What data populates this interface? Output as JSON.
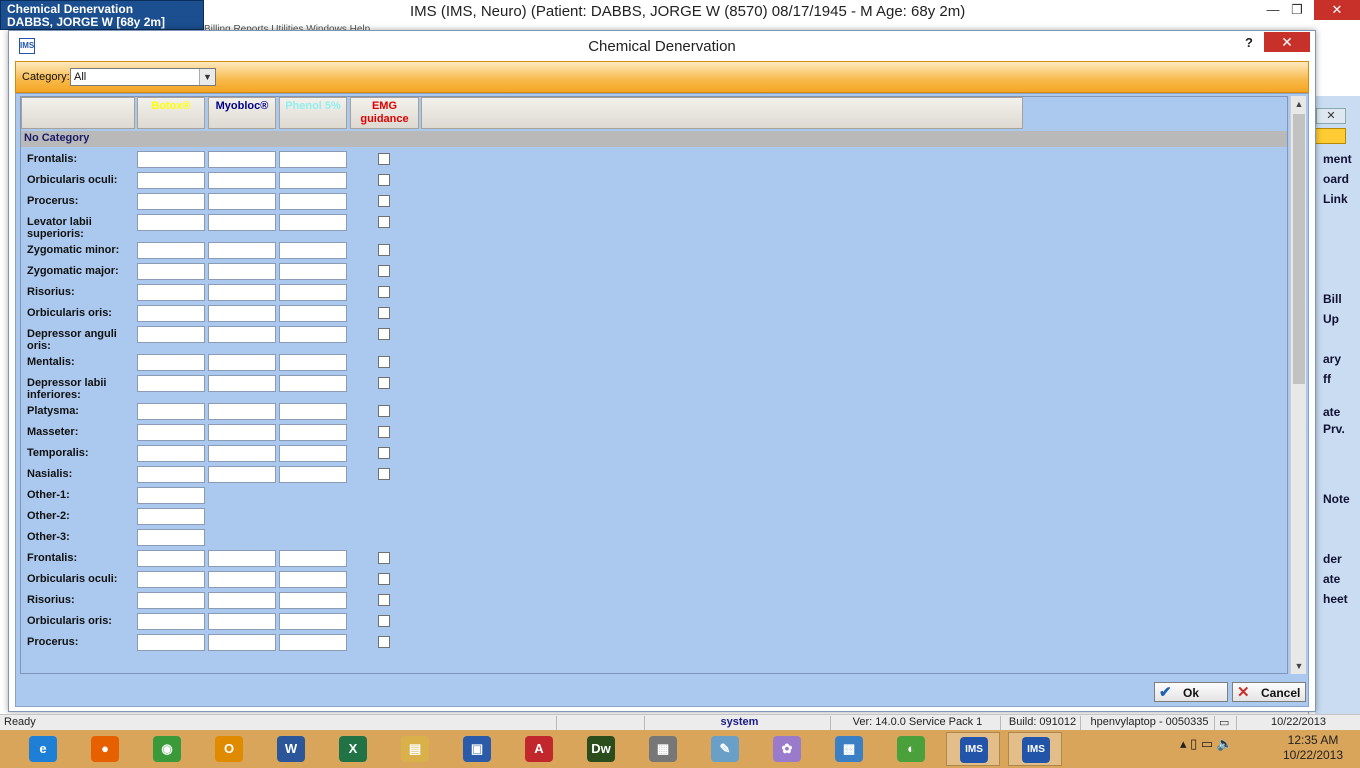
{
  "app": {
    "patient_line1": "Chemical Denervation",
    "patient_line2": "DABBS, JORGE W  [68y 2m]",
    "title": "IMS (IMS, Neuro)    (Patient: DABBS, JORGE W (8570) 08/17/1945 - M Age: 68y 2m)",
    "menu_fragment": "Billing  Reports  Utilities  Windows  Help",
    "minimize": "—",
    "restore": "❐",
    "close": "✕"
  },
  "side_panel": {
    "close": "✕",
    "items": [
      "ment",
      "oard",
      "Link",
      "Bill",
      "Up",
      "ary",
      "ff",
      "ate",
      "Prv.",
      "Note",
      "der",
      "ate",
      "heet"
    ]
  },
  "dialog": {
    "title": "Chemical Denervation",
    "icon_text": "IMS",
    "help": "?",
    "close": "✕",
    "category_label": "Category:",
    "category_value": "All",
    "columns": [
      {
        "label": "",
        "color": "#000000"
      },
      {
        "label": "Botox®",
        "color": "#ffff00"
      },
      {
        "label": "Myobloc®",
        "color": "#00008b"
      },
      {
        "label": "Phenol 5%",
        "color": "#8ef0f0"
      },
      {
        "label": "EMG guidance",
        "color": "#e00000"
      }
    ],
    "category_row": "No Category",
    "muscles": [
      {
        "label": "Frontalis:",
        "inputs": 3,
        "check": true
      },
      {
        "label": "Orbicularis oculi:",
        "inputs": 3,
        "check": true
      },
      {
        "label": "Procerus:",
        "inputs": 3,
        "check": true
      },
      {
        "label": "Levator labii superioris:",
        "inputs": 3,
        "check": true
      },
      {
        "label": "Zygomatic minor:",
        "inputs": 3,
        "check": true
      },
      {
        "label": "Zygomatic major:",
        "inputs": 3,
        "check": true
      },
      {
        "label": "Risorius:",
        "inputs": 3,
        "check": true
      },
      {
        "label": "Orbicularis oris:",
        "inputs": 3,
        "check": true
      },
      {
        "label": "Depressor anguli oris:",
        "inputs": 3,
        "check": true
      },
      {
        "label": "Mentalis:",
        "inputs": 3,
        "check": true
      },
      {
        "label": "Depressor labii inferiores:",
        "inputs": 3,
        "check": true
      },
      {
        "label": "Platysma:",
        "inputs": 3,
        "check": true
      },
      {
        "label": "Masseter:",
        "inputs": 3,
        "check": true
      },
      {
        "label": "Temporalis:",
        "inputs": 3,
        "check": true
      },
      {
        "label": "Nasialis:",
        "inputs": 3,
        "check": true
      },
      {
        "label": "Other-1:",
        "inputs": 1,
        "check": false
      },
      {
        "label": "Other-2:",
        "inputs": 1,
        "check": false
      },
      {
        "label": "Other-3:",
        "inputs": 1,
        "check": false
      },
      {
        "label": "Frontalis:",
        "inputs": 3,
        "check": true
      },
      {
        "label": "Orbicularis oculi:",
        "inputs": 3,
        "check": true
      },
      {
        "label": "Risorius:",
        "inputs": 3,
        "check": true
      },
      {
        "label": "Orbicularis oris:",
        "inputs": 3,
        "check": true
      },
      {
        "label": "Procerus:",
        "inputs": 3,
        "check": true
      }
    ],
    "ok_label": "Ok",
    "ok_icon": "✔",
    "cancel_label": "Cancel",
    "cancel_icon": "✕"
  },
  "statusbar": {
    "ready": "Ready",
    "user": "system",
    "version": "Ver: 14.0.0 Service Pack 1",
    "build": "Build: 091012",
    "machine": "hpenvylaptop - 0050335",
    "date": "10/22/2013"
  },
  "taskbar": {
    "apps": [
      {
        "name": "internet-explorer-icon",
        "glyph": "e",
        "color": "#1e7fd6"
      },
      {
        "name": "firefox-icon",
        "glyph": "●",
        "color": "#e66000"
      },
      {
        "name": "chrome-icon",
        "glyph": "◉",
        "color": "#3a9a3a"
      },
      {
        "name": "outlook-icon",
        "glyph": "O",
        "color": "#e08a00"
      },
      {
        "name": "word-icon",
        "glyph": "W",
        "color": "#2b579a"
      },
      {
        "name": "excel-icon",
        "glyph": "X",
        "color": "#217346"
      },
      {
        "name": "file-explorer-icon",
        "glyph": "▤",
        "color": "#d9b04a"
      },
      {
        "name": "remote-desktop-icon",
        "glyph": "▣",
        "color": "#2a5aa8"
      },
      {
        "name": "acrobat-icon",
        "glyph": "A",
        "color": "#c1272d"
      },
      {
        "name": "dreamweaver-icon",
        "glyph": "Dw",
        "color": "#2b4d1c"
      },
      {
        "name": "calculator-icon",
        "glyph": "▦",
        "color": "#777777"
      },
      {
        "name": "notepad-icon",
        "glyph": "✎",
        "color": "#6aa0c8"
      },
      {
        "name": "paint-icon",
        "glyph": "✿",
        "color": "#9a7acb"
      },
      {
        "name": "control-panel-icon",
        "glyph": "▩",
        "color": "#3b7fc4"
      },
      {
        "name": "dragon-icon",
        "glyph": "◐",
        "color": "#4aa03a"
      },
      {
        "name": "ims-icon",
        "glyph": "IMS",
        "color": "#2255aa"
      },
      {
        "name": "ims-icon-2",
        "glyph": "IMS",
        "color": "#2255aa"
      }
    ],
    "tray": "▴  ▯  ▭  🔈",
    "time": "12:35 AM",
    "date": "10/22/2013"
  }
}
